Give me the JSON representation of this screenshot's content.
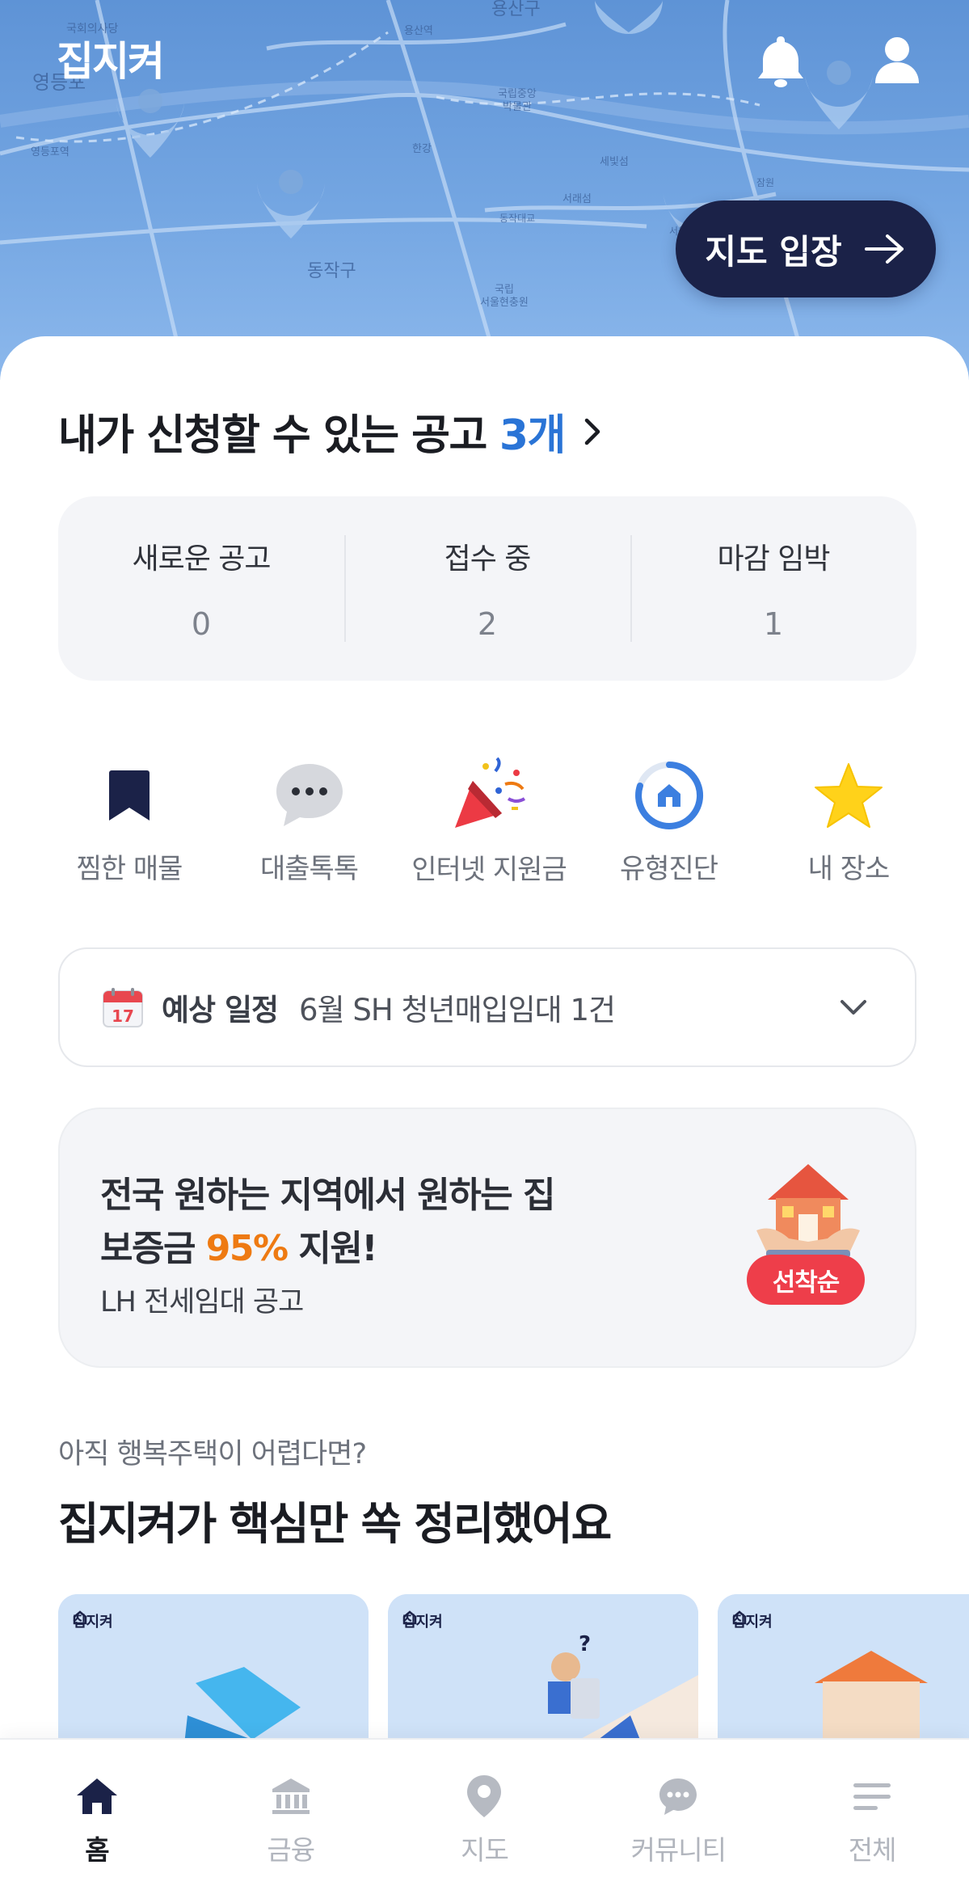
{
  "header": {
    "logo": "집지켜",
    "map_enter_label": "지도 입장",
    "map_labels": [
      "영등포",
      "국회의사당",
      "용산역",
      "용산구",
      "국립중앙박물관",
      "한강",
      "세빛섬",
      "서래섬",
      "동작구",
      "국립서울현충원",
      "영등포역",
      "동작대교",
      "서울고속(경부)",
      "잠원"
    ]
  },
  "apply": {
    "title": "내가 신청할 수 있는 공고",
    "count": "3개"
  },
  "stats": [
    {
      "label": "새로운 공고",
      "value": "0"
    },
    {
      "label": "접수 중",
      "value": "2"
    },
    {
      "label": "마감 임박",
      "value": "1"
    }
  ],
  "shortcuts": [
    {
      "label": "찜한 매물",
      "icon": "bookmark-icon"
    },
    {
      "label": "대출톡톡",
      "icon": "chat-bubble-icon"
    },
    {
      "label": "인터넷 지원금",
      "icon": "party-popper-icon"
    },
    {
      "label": "유형진단",
      "icon": "home-diagnosis-icon"
    },
    {
      "label": "내 장소",
      "icon": "star-icon"
    }
  ],
  "schedule": {
    "calendar_day": "17",
    "title": "예상 일정",
    "text": "6월 SH 청년매입임대 1건"
  },
  "promo": {
    "line1": "전국 원하는 지역에서 원하는 집",
    "line2_prefix": "보증금 ",
    "line2_highlight": "95%",
    "line2_suffix": " 지원!",
    "subtitle": "LH 전세임대 공고",
    "badge": "선착순"
  },
  "section": {
    "subtitle": "아직 행복주택이 어렵다면?",
    "title": "집지켜가 핵심만 쏙 정리했어요"
  },
  "cards": [
    {
      "brand": "집지켜"
    },
    {
      "brand": "집지켜"
    },
    {
      "brand": "집지켜"
    }
  ],
  "nav": [
    {
      "label": "홈",
      "icon": "home-icon",
      "active": true
    },
    {
      "label": "금융",
      "icon": "bank-icon",
      "active": false
    },
    {
      "label": "지도",
      "icon": "map-pin-icon",
      "active": false
    },
    {
      "label": "커뮤니티",
      "icon": "community-chat-icon",
      "active": false
    },
    {
      "label": "전체",
      "icon": "menu-icon",
      "active": false
    }
  ],
  "colors": {
    "accent": "#2a74d6",
    "dark_button": "#1b2248",
    "highlight_orange": "#ee7a12",
    "badge_red": "#ee3e4a",
    "map_blue": "#6d9fdd"
  }
}
